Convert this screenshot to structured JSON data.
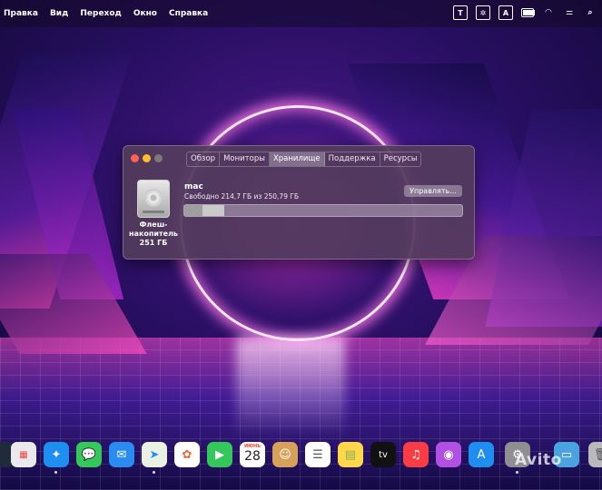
{
  "menubar": {
    "items": [
      "Правка",
      "Вид",
      "Переход",
      "Окно",
      "Справка"
    ],
    "status_icons": [
      "text-input-icon",
      "accessibility-icon",
      "a-icon",
      "battery-icon",
      "wifi-icon",
      "control-center-icon",
      "search-icon"
    ],
    "text_input_label": "T",
    "a_label": "A"
  },
  "window": {
    "tabs": [
      {
        "label": "Обзор",
        "active": false
      },
      {
        "label": "Мониторы",
        "active": false
      },
      {
        "label": "Хранилище",
        "active": true
      },
      {
        "label": "Поддержка",
        "active": false
      },
      {
        "label": "Ресурсы",
        "active": false
      }
    ],
    "storage": {
      "drive_label": "Флеш-накопитель 251 ГБ",
      "volume_name": "mac",
      "free_text": "Свободно 214,7 ГБ из 250,79 ГБ",
      "manage_label": "Управлять...",
      "used_fraction": 0.144
    }
  },
  "dock": {
    "icons": [
      "launchpad-icon",
      "safari-icon",
      "messages-icon",
      "mail-icon",
      "maps-icon",
      "photos-icon",
      "facetime-icon",
      "calendar-icon",
      "contacts-icon",
      "reminders-icon",
      "notes-icon",
      "apple-tv-icon",
      "music-icon",
      "podcasts-icon",
      "app-store-icon",
      "system-preferences-icon",
      "folder-icon",
      "trash-icon"
    ],
    "calendar_month": "ИЮНЬ",
    "calendar_day": "28",
    "tv_label": "tv"
  },
  "watermark": "Avito",
  "colors": {
    "window_bg": "#523a5c",
    "accent_red": "#ff5f57",
    "accent_yellow": "#febc2e"
  }
}
